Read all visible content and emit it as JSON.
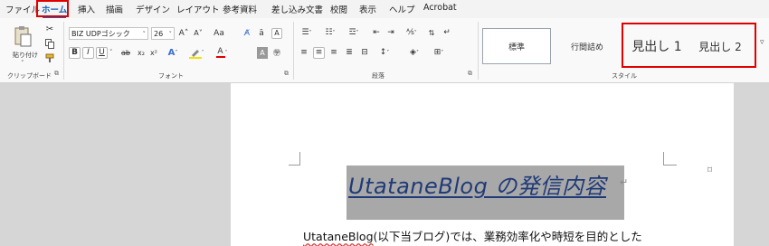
{
  "menu": {
    "tabs": [
      {
        "label": "ファイル",
        "active": false
      },
      {
        "label": "ホーム",
        "active": true
      },
      {
        "label": "挿入",
        "active": false
      },
      {
        "label": "描画",
        "active": false
      },
      {
        "label": "デザイン",
        "active": false
      },
      {
        "label": "レイアウト",
        "active": false
      },
      {
        "label": "参考資料",
        "active": false
      },
      {
        "label": "差し込み文書",
        "active": false
      },
      {
        "label": "校閲",
        "active": false
      },
      {
        "label": "表示",
        "active": false
      },
      {
        "label": "ヘルプ",
        "active": false
      },
      {
        "label": "Acrobat",
        "active": false
      }
    ]
  },
  "clipboard": {
    "paste_label": "貼り付け",
    "group_label": "クリップボード"
  },
  "font": {
    "name": "BIZ UDPゴシック",
    "size": "26",
    "group_label": "フォント",
    "grow": "A˄",
    "shrink": "A˅",
    "case": "Aa",
    "bold": "B",
    "italic": "I",
    "underline": "U",
    "strike": "ab",
    "subscript": "x₂",
    "superscript": "x²"
  },
  "paragraph": {
    "group_label": "段落"
  },
  "styles": {
    "group_label": "スタイル",
    "items": [
      "標準",
      "行間詰め",
      "見出し 1",
      "見出し 2"
    ]
  },
  "document": {
    "title": "UtataneBlog の発信内容",
    "body_link": "UtataneBlog",
    "body_rest": "(以下当ブログ)では、業務効率化や時短を目的とした"
  },
  "colors": {
    "accent": "#1a5fb4",
    "highlight_red": "#e00000",
    "title_blue": "#1f3a78",
    "selection_gray": "#a8a8a8"
  }
}
